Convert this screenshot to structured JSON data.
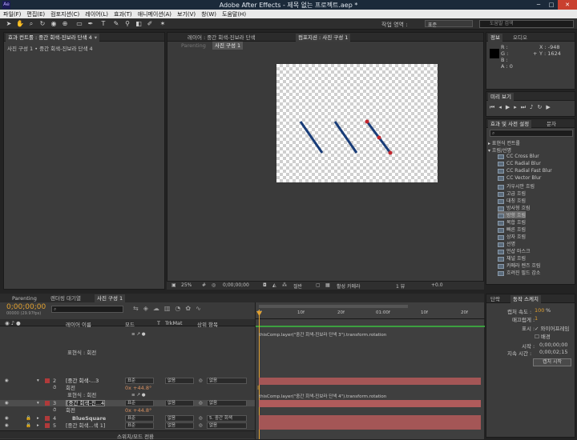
{
  "window": {
    "title": "Adobe After Effects - 제목 없는 프로젝트.aep *",
    "app_icon": "Ae",
    "buttons": [
      "minimize-icon",
      "maximize-icon",
      "close-icon"
    ]
  },
  "menu": [
    "파일(F)",
    "편집(E)",
    "컴포지션(C)",
    "레이어(L)",
    "효과(T)",
    "애니메이션(A)",
    "보기(V)",
    "창(W)",
    "도움말(H)"
  ],
  "toolbar": {
    "workspace_label": "작업 영역 :",
    "workspace_value": "표준",
    "search_placeholder": "도움말 검색"
  },
  "left_panel": {
    "tab": "효과 컨트롤 : 중간 회색-진보라 단색 4",
    "subtitle": "사진 구성 1 • 중간 회색-진보라 단색 4"
  },
  "viewer": {
    "tabs": [
      "레이어 : 중간 회색-진보라 단색",
      "컴포지션 : 사진 구성 1"
    ],
    "subtabs": [
      "Parenting",
      "사진 구성 1"
    ],
    "bottom_bar": {
      "zoom": "25%",
      "timecode": "0;00;00;00",
      "resolution": "절반",
      "camera": "활성 카메라",
      "views": "1 뷰",
      "offset": "+0.0"
    }
  },
  "info_panel": {
    "tabs": [
      "정보",
      "오디오"
    ],
    "r": "R :",
    "g": "G :",
    "b": "B :",
    "a": "A : 0",
    "x": "X : -948",
    "y": "Y : 1624"
  },
  "preview_panel": {
    "tab": "미리 보기"
  },
  "effects_panel": {
    "tabs": [
      "효과 및 사전 설정",
      "문자"
    ],
    "items": [
      "▸ 표현식 컨트롤",
      "▾ 흐림/선명",
      "CC Cross Blur",
      "CC Radial Blur",
      "CC Radial Fast Blur",
      "CC Vector Blur",
      "가우시안 흐림",
      "고급 흐림",
      "대칭 흐림",
      "방사형 흐림",
      "방향 흐림",
      "복합 흐림",
      "빠른 흐림",
      "상자 흐림",
      "선명",
      "언샵 마스크",
      "채널 흐림",
      "카메라 렌즈 흐림",
      "흐려진 필드 감소"
    ]
  },
  "paragraph_panel": {
    "tabs": [
      "단락",
      "동작 스케치"
    ],
    "capture_speed_label": "캡처 속도 :",
    "capture_speed": "100",
    "capture_speed_unit": "%",
    "smoothing_label": "매끄럽게 :",
    "smoothing": "1",
    "show_label": "표시 :",
    "wireframe": "와이어프레임",
    "background": "배경",
    "start_label": "시작 :",
    "start_time": "0;00;00;00",
    "duration_label": "지속 시간 :",
    "duration": "0;00;02;15",
    "capture_button": "캡처 시작"
  },
  "timeline": {
    "tabs": [
      "Parenting",
      "렌더링 대기열",
      "사진 구성 1"
    ],
    "timecode": "0;00;00;00",
    "fps": "00000 (29.97fps)",
    "columns": [
      "레이어 이름",
      "모드",
      "T",
      "TrkMat",
      "상위 항목"
    ],
    "ruler": [
      "0f",
      "10f",
      "20f",
      "01:00f",
      "10f",
      "20f"
    ],
    "rows": [
      {
        "kind": "prop",
        "name": "표현식 : 회전"
      },
      {
        "kind": "layer",
        "num": "2",
        "name": "[중간 회색-...3",
        "mode": "표준",
        "trk": "없음",
        "parent": "없음",
        "color": "#b03a3a"
      },
      {
        "kind": "prop",
        "name": "회전",
        "value": "0x +44.8°"
      },
      {
        "kind": "prop",
        "name": "표현식 : 회전"
      },
      {
        "kind": "layer",
        "num": "3",
        "name": "[중간 회색-진...4",
        "mode": "표준",
        "trk": "없음",
        "parent": "없음",
        "color": "#b03a3a"
      },
      {
        "kind": "prop",
        "name": "회전",
        "value": "0x +44.8°"
      },
      {
        "kind": "layer",
        "num": "4",
        "name": "BlueSquare",
        "mode": "표준",
        "trk": "없음",
        "parent": "5. 중간 회색",
        "color": "#b03a3a"
      },
      {
        "kind": "layer",
        "num": "5",
        "name": "[중간 회색...색 1]",
        "mode": "표준",
        "trk": "없음",
        "parent": "없음",
        "color": "#b03a3a"
      }
    ],
    "expressions": [
      "thisComp.layer(\"중간 회색-진보라 단색 3\").transform.rotation",
      "thisComp.layer(\"중간 회색-진보라 단색 4\").transform.rotation"
    ],
    "footer": "스위치/모드 전환"
  }
}
